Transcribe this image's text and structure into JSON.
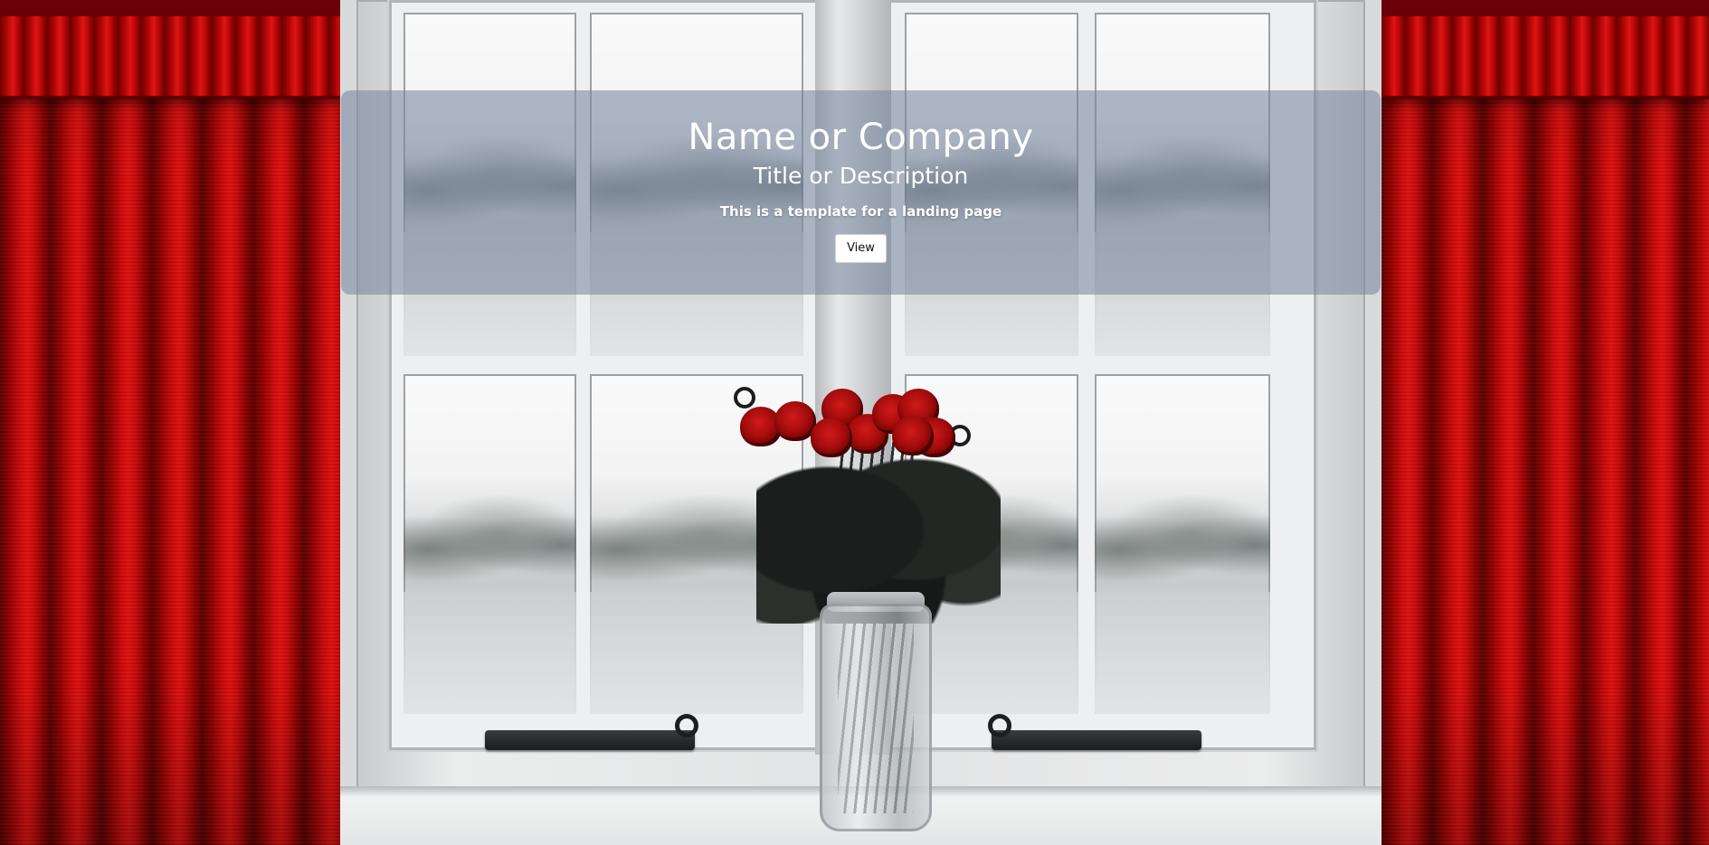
{
  "hero": {
    "title": "Name or Company",
    "subtitle": "Title or Description",
    "text": "This is a template for a landing page",
    "button_label": "View"
  },
  "colors": {
    "overlay": "#7888a0",
    "curtain": "#c80a0a",
    "rose": "#b0100f",
    "text": "#ffffff"
  }
}
